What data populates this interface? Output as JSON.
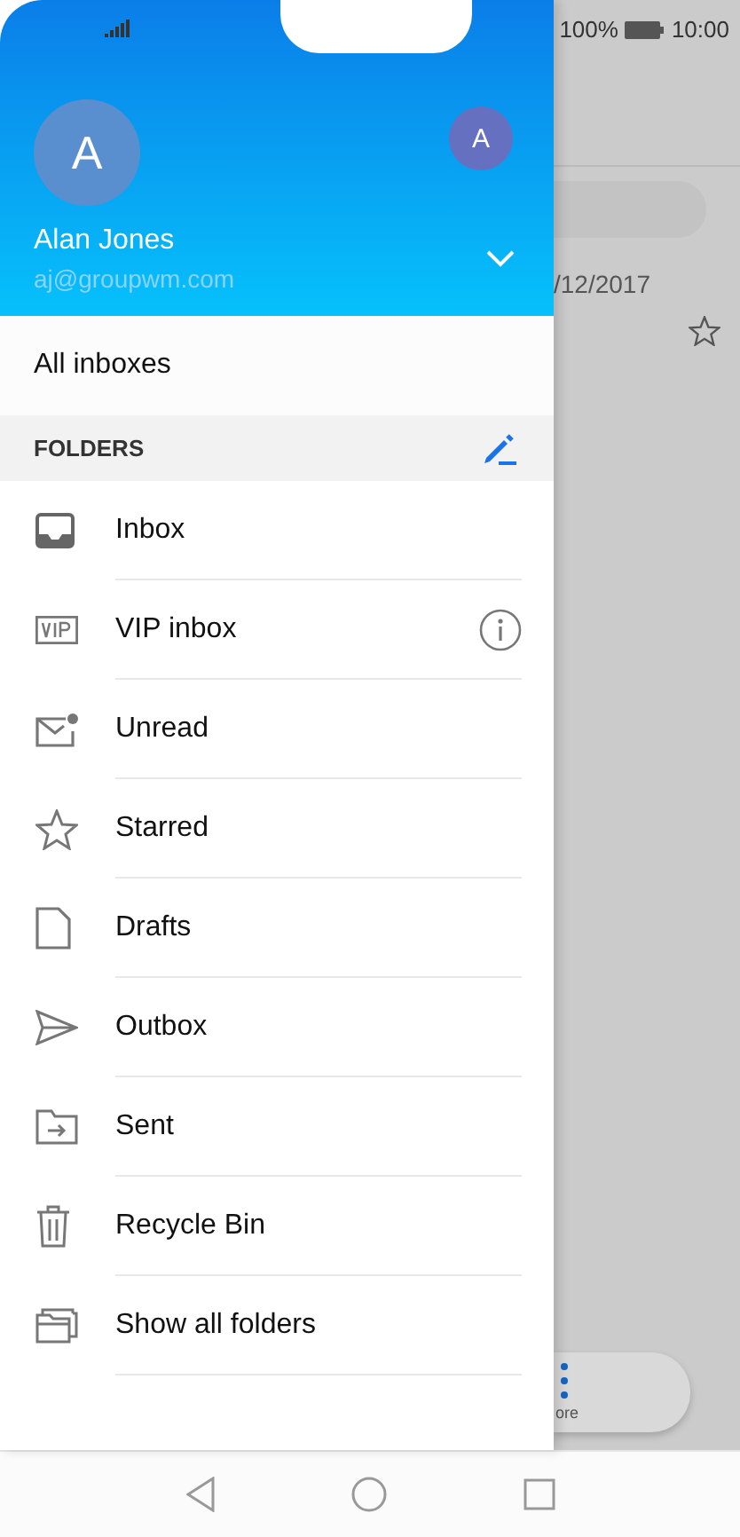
{
  "status_bar": {
    "battery": "100%",
    "time": "10:00"
  },
  "account": {
    "avatar": "A",
    "name": "Alan Jones",
    "email": "aj@groupwm.com",
    "switch_avatar": "A"
  },
  "all_inboxes": "All inboxes",
  "folders": {
    "title": "FOLDERS",
    "items": [
      {
        "label": "Inbox",
        "kind": "inbox",
        "info": false
      },
      {
        "label": "VIP inbox",
        "kind": "vip",
        "info": true
      },
      {
        "label": "Unread",
        "kind": "unread",
        "info": false
      },
      {
        "label": "Starred",
        "kind": "star",
        "info": false
      },
      {
        "label": "Drafts",
        "kind": "draft",
        "info": false
      },
      {
        "label": "Outbox",
        "kind": "outbox",
        "info": false
      },
      {
        "label": "Sent",
        "kind": "sent",
        "info": false
      },
      {
        "label": "Recycle Bin",
        "kind": "bin",
        "info": false
      },
      {
        "label": "Show all folders",
        "kind": "folders",
        "info": false
      }
    ]
  },
  "background_list": {
    "date": "/12/2017",
    "more_button": "ore"
  }
}
